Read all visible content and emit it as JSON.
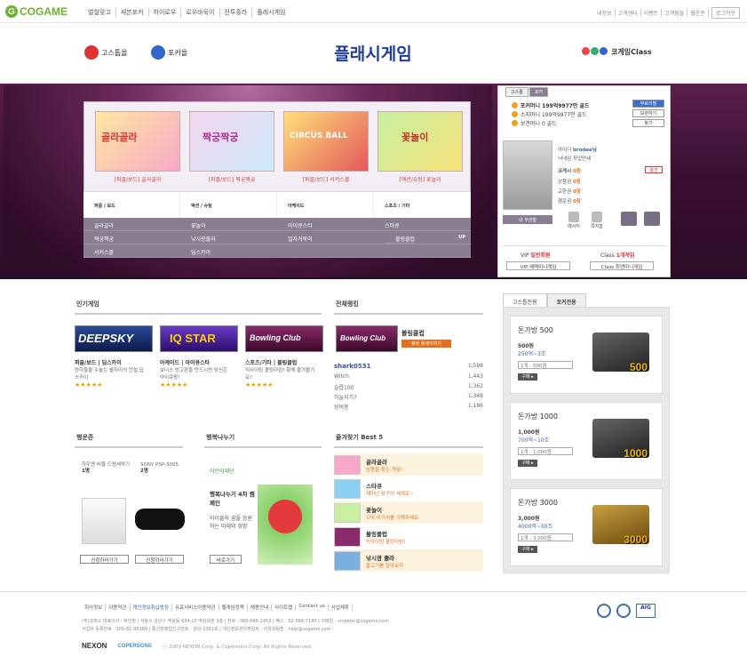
{
  "brand": {
    "logo": "COGAME"
  },
  "nav": {
    "main": [
      "벌칠맞고",
      "세븐포커",
      "하이로우",
      "로우바둑이",
      "전투홀라",
      "플래시게임"
    ],
    "util": [
      "내정보",
      "고객센터",
      "이벤트",
      "고객팀들",
      "웹운존"
    ],
    "logout": "로그아웃"
  },
  "sub": {
    "left1": "고스톱올",
    "left2": "포커올",
    "title": "플래시게임",
    "class": "코게임Class"
  },
  "games": [
    {
      "cap": "[퍼즐/보드] 골라골라",
      "title": "골라골라"
    },
    {
      "cap": "[퍼즐/보드] 짝궁짝궁",
      "title": "짝궁짝궁"
    },
    {
      "cap": "[퍼즐/보드] 서커스볼",
      "title": "CIRCUS BALL"
    },
    {
      "cap": "[액션/슈팅] 꽃놀이",
      "title": "꽃놀이"
    }
  ],
  "categories": [
    "퍼즐 / 보드",
    "액션 / 슈팅",
    "아케이드",
    "스포츠 / 기타"
  ],
  "gamelist": [
    [
      "골라골라",
      "꽃놀이",
      "아이큐스타",
      "스타큐"
    ],
    [
      "짝궁짝궁",
      "낚시광졸라",
      "일자거북이",
      "볼링클럽"
    ],
    [
      "서커스볼",
      "딥스카이",
      "",
      ""
    ]
  ],
  "gamelist_up": "UP",
  "account": {
    "tabs": [
      "고스톱",
      "포커"
    ],
    "poker_money": "포커머니 199억9977만 골드",
    "owned": "소지머니 199억9977만 골드",
    "vault": "보관머니 0 골드",
    "btn_free": "무료리필",
    "btn_store": "보관하기",
    "btn_view": "찾기",
    "id_label": "아이디",
    "id": "brodee님",
    "nick_label": "닉네임",
    "nick": "작업만세",
    "cogame_label": "코게시",
    "cogame": "0원",
    "charge": "충전",
    "bonus_label": "상품권",
    "bonus": "0원",
    "gift_label": "교환권",
    "gift": "0장",
    "lucky_label": "행운권",
    "lucky": "0장",
    "avbar": "내 부관함",
    "icons": [
      "메시지",
      "쪽지함",
      "",
      ""
    ],
    "vip_label": "VIP",
    "vip_val": "일반회원",
    "class_label": "Class",
    "class_val": "1개게임",
    "vip_btn": "VIP 혜택미니게임",
    "class_btn": "Class 최앤미니게임"
  },
  "popular": {
    "title": "인기게임",
    "items": [
      {
        "thumb": "DEEPSKY",
        "cat": "퍼즐/보드 | 딥스카이",
        "desc": "방하들을 수놓는 별자리의 전설,딥스카이"
      },
      {
        "thumb": "IQ STAR",
        "cat": "아케이드 | 아이큐스타",
        "desc": "보너스 빙고판을 만드시면 당신은 아이큐왕!"
      },
      {
        "thumb": "Bowling Club",
        "cat": "스포츠/기타 | 볼링클럽",
        "desc": "익사이팅 볼링타임! 함께 즐겨볼가요?"
      }
    ],
    "stars": "★★★★★"
  },
  "ranking": {
    "title": "전체랭킹",
    "game": "볼링클럽",
    "btn": "랭킹 플레이하기",
    "thumb": "Bowling Club",
    "rows": [
      [
        "shark0531",
        "1,598"
      ],
      [
        "Witch",
        "1,443"
      ],
      [
        "슬릅100",
        "1,362"
      ],
      [
        "하늘지기7",
        "1,348"
      ],
      [
        "빙버몽",
        "1,186"
      ]
    ]
  },
  "lucky": {
    "title": "행운존",
    "prizes": [
      {
        "name": "하우젠 비블 드럼세탁기",
        "count": "1명"
      },
      {
        "name": "SONY PSP-3005",
        "count": "2명"
      }
    ],
    "btn": "신청하러가기"
  },
  "share": {
    "title": "행복나누기",
    "org": "어린이재단",
    "headline": "행복나누기 4차 캠페인",
    "text": "아이들의 꿈을 응원하는 미래와 희망",
    "btn": "바로가기"
  },
  "bookmark": {
    "title": "즐겨찾기 Best 5",
    "items": [
      {
        "name": "골라골라",
        "desc": "상품을 찾는 게임!"
      },
      {
        "name": "스타큐",
        "desc": "재미난 당구의 세계로~"
      },
      {
        "name": "꽃놀이",
        "desc": "꼬마 아가씨를 구해주세요"
      },
      {
        "name": "볼링클럽",
        "desc": "익사이팅 볼링타임!"
      },
      {
        "name": "낚시광 졸라",
        "desc": "물고기를 잡아보자"
      }
    ]
  },
  "shop": {
    "tabs": [
      "고스톱전용",
      "포커전용"
    ],
    "rooms": [
      {
        "title": "돈가방 500",
        "price": "500원",
        "money": "250억~3조",
        "select": "1개 - 500원",
        "case": "500"
      },
      {
        "title": "돈가방 1000",
        "price": "1,000원",
        "money": "700억~10조",
        "select": "1개 - 1,000원",
        "case": "1000"
      },
      {
        "title": "돈가방 3000",
        "price": "3,000원",
        "money": "4000억~50조",
        "select": "1개 - 3,000원",
        "case": "3000"
      }
    ],
    "buy": "구매 ▸"
  },
  "footer": {
    "links": [
      "회사정보",
      "이용약관",
      "개인정보취급방침",
      "유료서비스이용약관",
      "웹게임정책",
      "채용안내",
      "사이트맵",
      "Contact us",
      "사업제휴"
    ],
    "line1": "(주)코퍼스 대표이사 : 박인범 | 서울시 강남구 역삼동 634-10 역삼회관 3층 | 전화 : 080-566-2453 | 팩스 : 02-566-7190 | 이메일 : cmaster@cogame.com",
    "line2": "사업자 등록번호 : 105-81-95389 | 통신판매업신고번호 : 강남-1361호 | 개인정보관리책임자 : 이학희팀장 : help@cogame.com",
    "nexon": "NEXON",
    "copersons": "COPERSONS",
    "copy": "ⓒ 2009 NEXON Corp. & Copersons Corp. All Rights Reserved.",
    "aig": "AIG"
  }
}
